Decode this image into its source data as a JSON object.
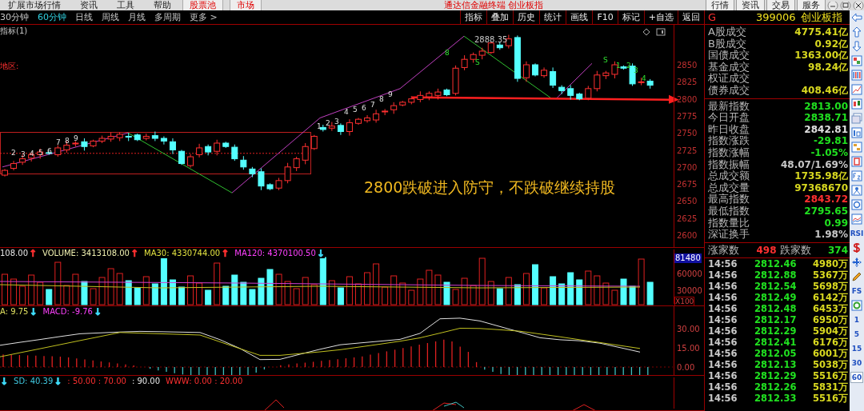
{
  "title_bar": {
    "menus": [
      "扩展市场行情",
      "资讯",
      "工具",
      "帮助"
    ],
    "tabs": [
      {
        "label": "股票池",
        "selected": false
      },
      {
        "label": "市场",
        "selected": false
      }
    ],
    "title": "通达信金融终端 创业板指",
    "buttons": [
      "行情",
      "资讯",
      "交易",
      "服务"
    ]
  },
  "periods": [
    {
      "label": "30分钟",
      "selected": false
    },
    {
      "label": "60分钟",
      "selected": true
    },
    {
      "label": "日线",
      "selected": false
    },
    {
      "label": "周线",
      "selected": false
    },
    {
      "label": "月线",
      "selected": false
    },
    {
      "label": "多周期",
      "selected": false
    },
    {
      "label": "更多 >",
      "selected": false
    }
  ],
  "toolbar": [
    "指标",
    "叠加",
    "历史",
    "统计",
    "画线",
    "F10",
    "标记",
    "+自选",
    "返回"
  ],
  "chart": {
    "indicator_label": "指标(1)",
    "region_label": "地区:",
    "high_label": "2888.35",
    "chart_data": {
      "type": "candlestick",
      "ylim": [
        2582.4,
        2908.7
      ],
      "yticks": [
        2850,
        2825,
        2800,
        2775,
        2750,
        2725,
        2700,
        2675,
        2650,
        2625,
        2600
      ],
      "ohlc": [
        [
          2688,
          2697,
          2686,
          2695
        ],
        [
          2698,
          2709,
          2695,
          2705
        ],
        [
          2707,
          2718,
          2703,
          2712
        ],
        [
          2713,
          2721,
          2708,
          2718
        ],
        [
          2718,
          2727,
          2712,
          2722
        ],
        [
          2721,
          2723,
          2718,
          2720
        ],
        [
          2718,
          2732,
          2715,
          2728
        ],
        [
          2725,
          2738,
          2721,
          2732
        ],
        [
          2735,
          2738,
          2730,
          2735
        ],
        [
          2737,
          2742,
          2724,
          2730
        ],
        [
          2731,
          2740,
          2729,
          2738
        ],
        [
          2738,
          2746,
          2735,
          2742
        ],
        [
          2741,
          2751,
          2737,
          2745
        ],
        [
          2743,
          2751,
          2738,
          2748
        ],
        [
          2745,
          2750,
          2738,
          2744
        ],
        [
          2747,
          2749,
          2738,
          2740
        ],
        [
          2742,
          2749,
          2739,
          2745
        ],
        [
          2746,
          2752,
          2738,
          2742
        ],
        [
          2742,
          2745,
          2733,
          2738
        ],
        [
          2737,
          2742,
          2719,
          2725
        ],
        [
          2723,
          2725,
          2703,
          2705
        ],
        [
          2702,
          2719,
          2699,
          2715
        ],
        [
          2718,
          2734,
          2714,
          2728
        ],
        [
          2730,
          2733,
          2717,
          2722
        ],
        [
          2723,
          2740,
          2717,
          2735
        ],
        [
          2735,
          2737,
          2728,
          2730
        ],
        [
          2729,
          2733,
          2709,
          2712
        ],
        [
          2710,
          2716,
          2696,
          2700
        ],
        [
          2697,
          2700,
          2685,
          2690
        ],
        [
          2693,
          2698,
          2666,
          2672
        ],
        [
          2674,
          2676,
          2666,
          2668
        ],
        [
          2669,
          2684,
          2666,
          2680
        ],
        [
          2680,
          2706,
          2676,
          2700
        ],
        [
          2699,
          2715,
          2694,
          2712
        ],
        [
          2710,
          2735,
          2704,
          2730
        ],
        [
          2727,
          2747,
          2725,
          2745
        ],
        [
          2758,
          2762,
          2752,
          2755
        ],
        [
          2757,
          2766,
          2753,
          2760
        ],
        [
          2761,
          2764,
          2747,
          2752
        ],
        [
          2752,
          2770,
          2746,
          2765
        ],
        [
          2764,
          2772,
          2762,
          2770
        ],
        [
          2768,
          2776,
          2765,
          2772
        ],
        [
          2769,
          2784,
          2765,
          2778
        ],
        [
          2781,
          2785,
          2776,
          2782
        ],
        [
          2784,
          2795,
          2778,
          2790
        ],
        [
          2791,
          2797,
          2789,
          2795
        ],
        [
          2795,
          2804,
          2792,
          2800
        ],
        [
          2799,
          2811,
          2795,
          2805
        ],
        [
          2803,
          2811,
          2798,
          2808
        ],
        [
          2805,
          2815,
          2799,
          2810
        ],
        [
          2813,
          2815,
          2804,
          2806
        ],
        [
          2808,
          2849,
          2805,
          2845
        ],
        [
          2846,
          2864,
          2842,
          2858
        ],
        [
          2858,
          2868,
          2853,
          2865
        ],
        [
          2864,
          2875,
          2858,
          2870
        ],
        [
          2868,
          2884,
          2866,
          2882
        ],
        [
          2879,
          2883,
          2872,
          2875
        ],
        [
          2878,
          2894,
          2874,
          2888
        ],
        [
          2890,
          2893,
          2825,
          2830
        ],
        [
          2831,
          2855,
          2825,
          2850
        ],
        [
          2850,
          2852,
          2833,
          2835
        ],
        [
          2834,
          2846,
          2831,
          2842
        ],
        [
          2840,
          2846,
          2816,
          2820
        ],
        [
          2817,
          2820,
          2807,
          2812
        ],
        [
          2815,
          2820,
          2799,
          2805
        ],
        [
          2807,
          2809,
          2798,
          2800
        ],
        [
          2801,
          2819,
          2798,
          2815
        ],
        [
          2815,
          2841,
          2811,
          2835
        ],
        [
          2834,
          2841,
          2829,
          2838
        ],
        [
          2836,
          2855,
          2830,
          2850
        ],
        [
          2847,
          2849,
          2843,
          2845
        ],
        [
          2848,
          2852,
          2819,
          2822
        ],
        [
          2824,
          2831,
          2820,
          2825
        ],
        [
          2826,
          2829,
          2815,
          2820
        ]
      ]
    },
    "td_marks": [
      "2",
      "3",
      "4",
      "5",
      "6",
      "7",
      "8",
      "9",
      "1",
      "2",
      "3",
      "4",
      "5",
      "6",
      "7",
      "8",
      "9",
      "8",
      "S",
      "S",
      "1",
      "2",
      "3",
      "4"
    ],
    "annotation": "2800跌破进入防守，不跌破继续持股"
  },
  "volume": {
    "legend": [
      {
        "text": "108.00",
        "kind": "value",
        "color": "#e8e8e8"
      },
      {
        "text": "↑",
        "kind": "arrow",
        "color": "#ff3030"
      },
      {
        "text": "VOLUME: 3413108.00",
        "kind": "value",
        "color": "#f0f0b0"
      },
      {
        "text": "↑",
        "kind": "arrow",
        "color": "#ff3030"
      },
      {
        "text": "MA30: 4330744.00",
        "kind": "value",
        "color": "#e0e040"
      },
      {
        "text": "↑",
        "kind": "arrow",
        "color": "#ff3030"
      },
      {
        "text": "MA120: 4370100.50",
        "kind": "value",
        "color": "#ff40ff"
      },
      {
        "text": "↓",
        "kind": "arrow",
        "color": "#40e0ff"
      }
    ],
    "max_label": "81480",
    "axis": [
      "60000",
      "30000"
    ],
    "scale_label": "X100"
  },
  "macd": {
    "legend": [
      {
        "text": "A: 9.75",
        "kind": "value",
        "color": "#e0e060"
      },
      {
        "text": "↓",
        "kind": "arrow",
        "color": "#40e0ff"
      },
      {
        "text": "MACD: -9.76",
        "kind": "value",
        "color": "#ff40ff"
      },
      {
        "text": "↓",
        "kind": "arrow",
        "color": "#40e0ff"
      }
    ],
    "chart_data": {
      "type": "line",
      "ylim": [
        -6.25,
        47.5
      ],
      "yticks": [
        {
          "value": 30,
          "label": "30.00"
        },
        {
          "value": 15,
          "label": "15.00"
        },
        {
          "value": 0,
          "label": "0.00"
        }
      ],
      "series": [
        {
          "color": "#e0e0e0",
          "values": [
            17,
            19.3,
            21.5,
            23.8,
            26,
            26.7,
            27.4,
            27.9,
            27.6,
            27.3,
            27,
            21.4,
            14.5,
            5.8,
            6,
            10,
            13.9,
            17.4,
            18.8,
            20.2,
            21.6,
            26.3,
            37.7,
            38.2,
            36,
            31.6,
            27.3,
            22.9,
            21.3,
            20.5,
            18.6,
            15.2,
            11.7
          ]
        },
        {
          "color": "#c0c020",
          "values": [
            8,
            11.2,
            14.3,
            17.5,
            20.7,
            23.8,
            27,
            26.5,
            26,
            25.5,
            25,
            19.7,
            14.4,
            9.1,
            9.1,
            10.5,
            11.9,
            13.5,
            15.7,
            17.9,
            20.2,
            22.8,
            26.5,
            30.3,
            30.1,
            29.1,
            28,
            25.8,
            23.6,
            21.3,
            19.1,
            16.8,
            14.5
          ]
        }
      ]
    }
  },
  "lower_indicator": {
    "legend": [
      {
        "text": "↓",
        "kind": "arrow",
        "color": "#40e0ff"
      },
      {
        "text": "SD: 40.39",
        "kind": "value",
        "color": "#40c8e0"
      },
      {
        "text": "↓",
        "kind": "arrow",
        "color": "#40e0ff"
      },
      {
        "text": ": 50.00 : 70.00",
        "kind": "value",
        "color": "#ff3030"
      },
      {
        "text": ": 90.00",
        "kind": "value",
        "color": "#e8e8e8"
      },
      {
        "text": "WWW: 0.00 : 20.00",
        "kind": "value",
        "color": "#ff3030"
      }
    ]
  },
  "quote": {
    "badge": "G",
    "code": "399006",
    "name": "创业板指",
    "sections": [
      {
        "rows": [
          {
            "label": "A股成交",
            "value": "4775.41亿",
            "color": "#d8d820"
          },
          {
            "label": "B股成交",
            "value": "0.92亿",
            "color": "#d8d820"
          },
          {
            "label": "国债成交",
            "value": "1363.00亿",
            "color": "#d8d820"
          },
          {
            "label": "基金成交",
            "value": "98.24亿",
            "color": "#d8d820"
          },
          {
            "label": "权证成交"
          },
          {
            "label": "债券成交",
            "value": "408.46亿",
            "color": "#d8d820"
          }
        ]
      },
      {
        "rows": [
          {
            "label": "最新指数",
            "value": "2813.00",
            "color": "#20e020"
          },
          {
            "label": "今日开盘",
            "value": "2838.71",
            "color": "#20e020"
          },
          {
            "label": "昨日收盘",
            "value": "2842.81",
            "color": "#e0e0e0"
          },
          {
            "label": "指数涨跌",
            "value": "-29.81",
            "color": "#20e020"
          },
          {
            "label": "指数涨幅",
            "value": "-1.05%",
            "color": "#20e020"
          },
          {
            "label": "指数振幅",
            "value": "48.07/1.69%",
            "color": "#c8c8c8"
          },
          {
            "label": "总成交额",
            "value": "1735.98亿",
            "color": "#d8d820"
          },
          {
            "label": "总成交量",
            "value": "97368670",
            "color": "#d8d820"
          },
          {
            "label": "最高指数",
            "value": "2843.72",
            "color": "#ff3030"
          },
          {
            "label": "最低指数",
            "value": "2795.65",
            "color": "#20e020"
          },
          {
            "label": "指数量比",
            "value": "0.99",
            "color": "#20e020"
          },
          {
            "label": "深证换手",
            "value": "1.98%",
            "color": "#c8c8c8"
          }
        ]
      }
    ],
    "breadth": {
      "up_label": "涨家数",
      "up_count": "498",
      "down_label": "跌家数",
      "down_count": "374"
    },
    "ticks": [
      {
        "time": "14:56",
        "price": "2812.46",
        "volume": "4980万"
      },
      {
        "time": "14:56",
        "price": "2812.88",
        "volume": "5367万"
      },
      {
        "time": "14:56",
        "price": "2812.54",
        "volume": "5698万"
      },
      {
        "time": "14:56",
        "price": "2812.49",
        "volume": "6142万"
      },
      {
        "time": "14:56",
        "price": "2812.48",
        "volume": "6453万"
      },
      {
        "time": "14:56",
        "price": "2812.17",
        "volume": "6950万"
      },
      {
        "time": "14:56",
        "price": "2812.29",
        "volume": "5904万"
      },
      {
        "time": "14:56",
        "price": "2812.41",
        "volume": "6176万"
      },
      {
        "time": "14:56",
        "price": "2812.05",
        "volume": "6001万"
      },
      {
        "time": "14:56",
        "price": "2812.13",
        "volume": "5038万"
      },
      {
        "time": "14:56",
        "price": "2812.29",
        "volume": "5516万"
      },
      {
        "time": "14:56",
        "price": "2812.26",
        "volume": "5831万"
      },
      {
        "time": "14:56",
        "price": "2812.33",
        "volume": "5516万"
      }
    ]
  },
  "side_toolbar": [
    {
      "kind": "icon"
    },
    {
      "kind": "icon"
    },
    {
      "kind": "icon"
    },
    {
      "kind": "icon"
    },
    {
      "kind": "icon"
    },
    {
      "kind": "icon"
    },
    {
      "kind": "icon"
    },
    {
      "kind": "icon"
    },
    {
      "kind": "icon"
    },
    {
      "kind": "icon"
    },
    {
      "kind": "icon"
    },
    {
      "kind": "icon"
    },
    {
      "kind": "icon"
    },
    {
      "kind": "icon"
    },
    {
      "kind": "icon"
    },
    {
      "kind": "label",
      "text": "RSI",
      "selected": false
    },
    {
      "kind": "icon"
    },
    {
      "kind": "icon"
    },
    {
      "kind": "icon"
    },
    {
      "kind": "label",
      "text": "FS",
      "selected": false
    },
    {
      "kind": "icon"
    },
    {
      "kind": "label",
      "text": "1",
      "selected": false
    },
    {
      "kind": "label",
      "text": "5",
      "selected": false
    },
    {
      "kind": "label",
      "text": "15",
      "selected": false
    },
    {
      "kind": "label",
      "text": "30",
      "selected": false
    },
    {
      "kind": "label",
      "text": "60",
      "selected": true
    }
  ]
}
